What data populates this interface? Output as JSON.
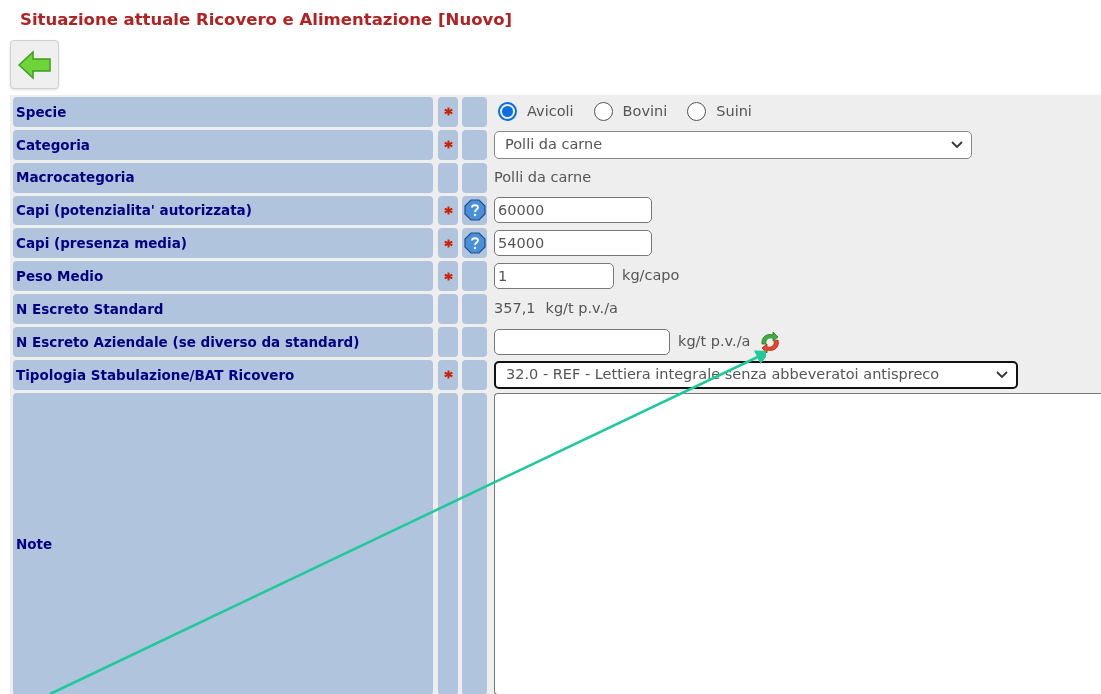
{
  "title": "Situazione attuale Ricovero e Alimentazione [Nuovo]",
  "rows": [
    {
      "label": "Specie",
      "required": true,
      "help": false,
      "kind": "radio",
      "options": [
        {
          "label": "Avicoli",
          "selected": true
        },
        {
          "label": "Bovini",
          "selected": false
        },
        {
          "label": "Suini",
          "selected": false
        }
      ]
    },
    {
      "label": "Categoria",
      "required": true,
      "help": false,
      "kind": "select",
      "value": "Polli da carne",
      "focused": false
    },
    {
      "label": "Macrocategoria",
      "required": false,
      "help": false,
      "kind": "text",
      "value": "Polli da carne"
    },
    {
      "label": "Capi (potenzialita' autorizzata)",
      "required": true,
      "help": true,
      "kind": "input",
      "value": "60000"
    },
    {
      "label": "Capi (presenza media)",
      "required": true,
      "help": true,
      "kind": "input",
      "value": "54000"
    },
    {
      "label": "Peso Medio",
      "required": true,
      "help": false,
      "kind": "input",
      "value": "1",
      "unit": "kg/capo"
    },
    {
      "label": "N Escreto Standard",
      "required": false,
      "help": false,
      "kind": "text",
      "value": "357,1",
      "unit": "kg/t p.v./a"
    },
    {
      "label": "N Escreto Aziendale (se diverso da standard)",
      "required": false,
      "help": false,
      "kind": "input",
      "unit": "kg/t p.v./a",
      "refresh": true
    },
    {
      "label": "Tipologia Stabulazione/BAT Ricovero",
      "required": true,
      "help": false,
      "kind": "select",
      "value": "32.0 - REF - Lettiera integrale senza abbeveratoi antispreco",
      "focused": true
    },
    {
      "label": "Note",
      "required": false,
      "help": false,
      "kind": "textarea"
    }
  ]
}
